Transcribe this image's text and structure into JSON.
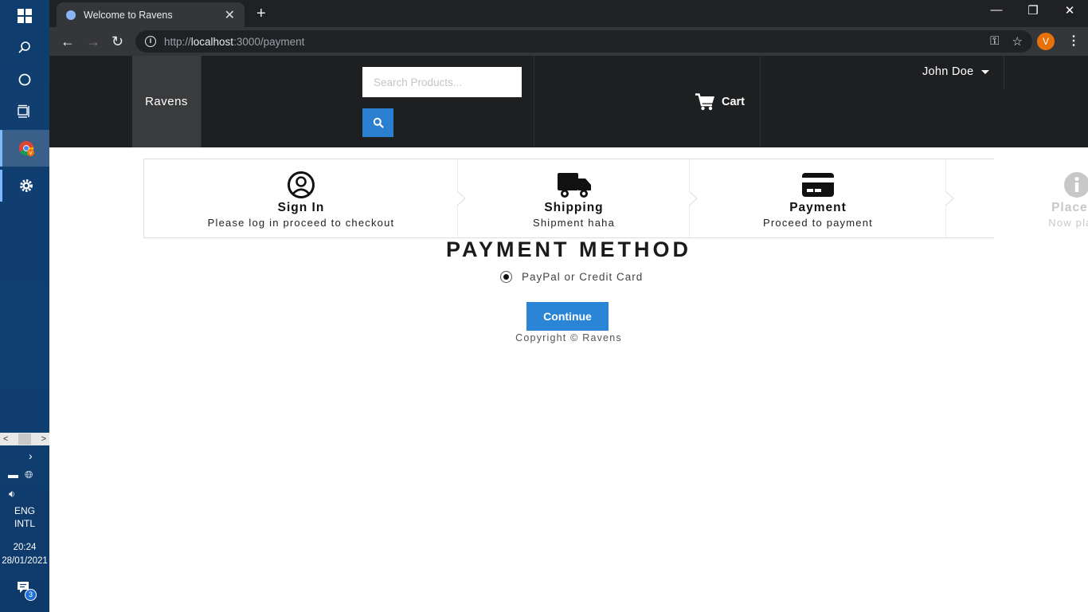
{
  "taskbar": {
    "lang_line1": "ENG",
    "lang_line2": "INTL",
    "time": "20:24",
    "date": "28/01/2021",
    "notification_count": "3",
    "profile_letter": "V"
  },
  "browser": {
    "tab_title": "Welcome to Ravens",
    "url_prefix": "http://",
    "url_host": "localhost",
    "url_rest": ":3000/payment",
    "profile_initial": "V"
  },
  "navbar": {
    "brand": "Ravens",
    "search_placeholder": "Search Products...",
    "cart_label": "Cart",
    "user_name": "John Doe"
  },
  "steps": [
    {
      "title": "Sign In",
      "subtitle": "Please log in proceed to checkout",
      "icon": "user-circle-icon",
      "state": "done"
    },
    {
      "title": "Shipping",
      "subtitle": "Shipment haha",
      "icon": "truck-icon",
      "state": "done"
    },
    {
      "title": "Payment",
      "subtitle": "Proceed to payment",
      "icon": "credit-card-icon",
      "state": "active"
    },
    {
      "title": "Place O",
      "subtitle": "Now place",
      "icon": "info-icon",
      "state": "disabled"
    }
  ],
  "payment": {
    "heading": "PAYMENT METHOD",
    "option_label": "PayPal or Credit Card",
    "option_selected": true,
    "continue_label": "Continue"
  },
  "footer": {
    "copyright": "Copyright © Ravens"
  },
  "colors": {
    "accent": "#2a85d6",
    "navbar_bg": "#1d1f21"
  }
}
